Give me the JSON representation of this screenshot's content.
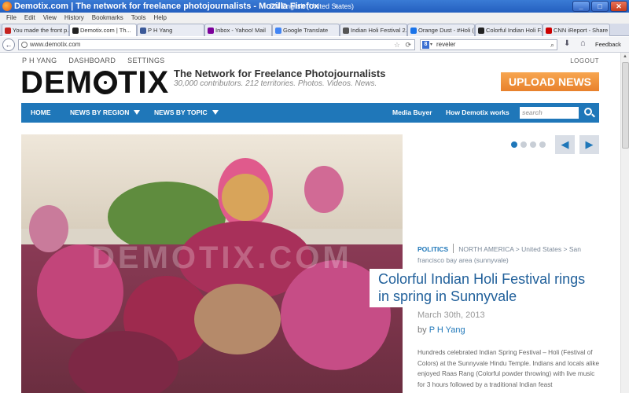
{
  "window": {
    "title": "Demotix.com | The network for freelance photojournalists - Mozilla Firefox",
    "language": "EN English (United States)",
    "language_arrow": "»",
    "min_label": "_",
    "max_label": "□",
    "close_label": "✕"
  },
  "menu": [
    "File",
    "Edit",
    "View",
    "History",
    "Bookmarks",
    "Tools",
    "Help"
  ],
  "tabs": [
    {
      "label": "You made the front p...",
      "favicon_color": "#c5221f"
    },
    {
      "label": "Demotix.com | Th...",
      "favicon_color": "#222222",
      "active": true
    },
    {
      "label": "P H Yang",
      "favicon_color": "#3b5998"
    },
    {
      "label": "Inbox - Yahoo! Mail",
      "favicon_color": "#7b0099"
    },
    {
      "label": "Google Translate",
      "favicon_color": "#4285f4"
    },
    {
      "label": "Indian Holi Festival 2...",
      "favicon_color": "#555555"
    },
    {
      "label": "Orange Dust - #Holi (...",
      "favicon_color": "#1a73e8"
    },
    {
      "label": "Colorful Indian Holi F...",
      "favicon_color": "#222222"
    },
    {
      "label": "CNN iReport - Share ...",
      "favicon_color": "#cc0000"
    }
  ],
  "nav": {
    "back_icon": "←",
    "url": "www.demotix.com",
    "bookmark_star": "☆",
    "reload_icon": "⟳",
    "search_engine_letter": "8",
    "search_dropdown": "▾",
    "search_value": "reveler",
    "search_icon": "⌕",
    "downloads_icon": "⬇",
    "home_icon": "⌂",
    "feedback": "Feedback"
  },
  "scrollbar": {
    "up_arrow": "▲"
  },
  "site": {
    "user_links": [
      "P H YANG",
      "DASHBOARD",
      "SETTINGS"
    ],
    "logout": "LOGOUT",
    "logo_left": "DEM",
    "logo_right": "TIX",
    "tagline": "The Network for Freelance Photojournalists",
    "subtagline": "30,000 contributors. 212 territories. Photos. Videos. News.",
    "upload_button": "UPLOAD NEWS",
    "menu": {
      "home": "HOME",
      "by_region": "NEWS BY REGION",
      "by_topic": "NEWS BY TOPIC",
      "media_buyer": "Media Buyer",
      "how_it_works": "How Demotix works",
      "search_placeholder": "search"
    },
    "hero_watermark": "DEMOTIX.COM",
    "carousel": {
      "slide_count": 4,
      "active_slide": 1,
      "prev_label": "◀",
      "next_label": "▶"
    },
    "article": {
      "category": "POLITICS",
      "region_path": "NORTH AMERICA  >  United States  >  San francisco bay area (sunnyvale)",
      "headline": "Colorful Indian Holi Festival rings in spring in Sunnyvale",
      "date": "March 30th, 2013",
      "by_prefix": "by ",
      "author": "P H Yang",
      "body": "Hundreds celebrated Indian Spring Festival – Holi (Festival of Colors) at the Sunnyvale Hindu Temple. Indians and locals alike enjoyed Raas Rang (Colorful powder throwing) with live music for 3 hours followed by a traditional Indian feast"
    }
  },
  "colors": {
    "accent": "#1f77b9",
    "upload": "#f0922e",
    "headline": "#1f5f9a"
  }
}
